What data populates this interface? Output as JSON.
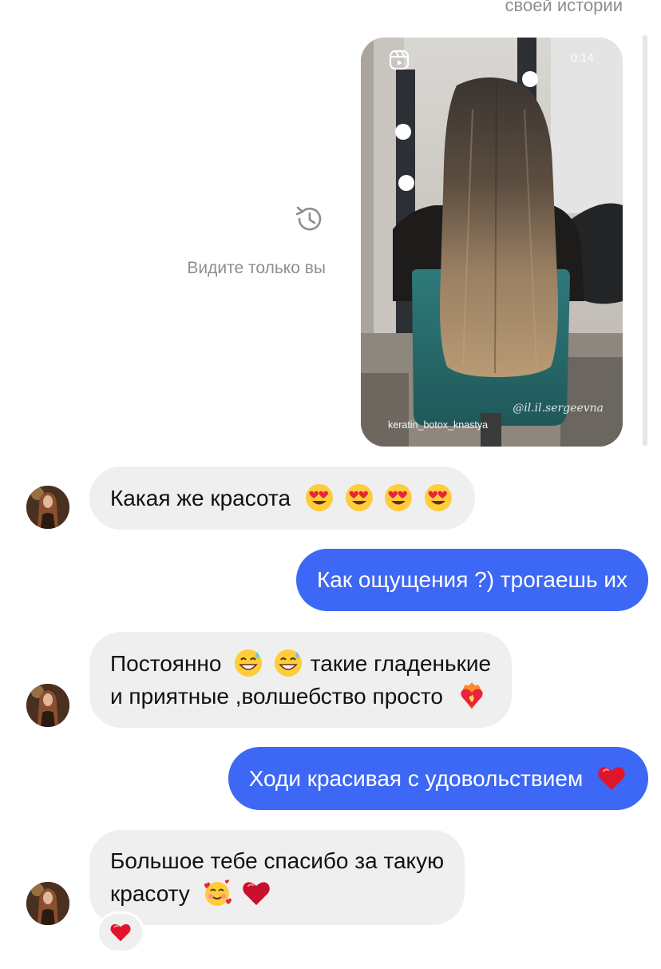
{
  "story_reply": {
    "caption": "своей истории",
    "visibility_note": "Видите только вы",
    "duration": "0:14",
    "watermark": "@il.il.sergeevna",
    "tag": "keratin_botox_knastya"
  },
  "messages": [
    {
      "direction": "incoming",
      "text": "Какая же красота",
      "emojis": [
        "smiling-face-with-heart-eyes",
        "smiling-face-with-heart-eyes",
        "smiling-face-with-heart-eyes",
        "smiling-face-with-heart-eyes"
      ]
    },
    {
      "direction": "outgoing",
      "text": "Как ощущения ?) трогаешь их"
    },
    {
      "direction": "incoming",
      "line1_a": "Постоянно",
      "line1_b": "такие гладенькие",
      "line2": "и приятные ,волшебство просто",
      "emojis": [
        "grinning-face-with-sweat",
        "grinning-face-with-sweat",
        "heart-on-fire"
      ]
    },
    {
      "direction": "outgoing",
      "text": "Ходи красивая с удовольствием",
      "emojis": [
        "red-heart"
      ]
    },
    {
      "direction": "incoming",
      "line1": "Большое тебе спасибо за такую",
      "line2": "красоту",
      "emojis": [
        "smiling-face-with-hearts",
        "red-heart"
      ],
      "reaction": "red-heart"
    }
  ],
  "colors": {
    "outgoing_bubble": "#3d67f5",
    "incoming_bubble": "#efefef",
    "muted_text": "#8e8e8e"
  }
}
